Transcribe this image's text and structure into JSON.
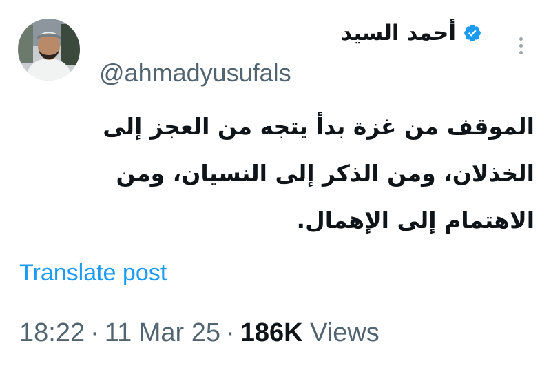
{
  "author": {
    "display_name": "أحمد السيد",
    "handle": "@ahmadyusufals",
    "verified_icon": "verified-badge-icon",
    "avatar_icon": "avatar-photo"
  },
  "post": {
    "text": "الموقف من غزة بدأ يتجه من العجز إلى الخذلان، ومن الذكر إلى النسيان، ومن الاهتمام إلى الإهمال."
  },
  "actions": {
    "translate_label": "Translate post",
    "more_icon": "more-options-icon"
  },
  "meta": {
    "time": "18:22",
    "separator": "·",
    "date": "11 Mar 25",
    "views_count": "186K",
    "views_label": "Views"
  },
  "colors": {
    "accent": "#1d9bf0",
    "text_primary": "#0f1419",
    "text_secondary": "#536471",
    "background": "#ffffff"
  }
}
